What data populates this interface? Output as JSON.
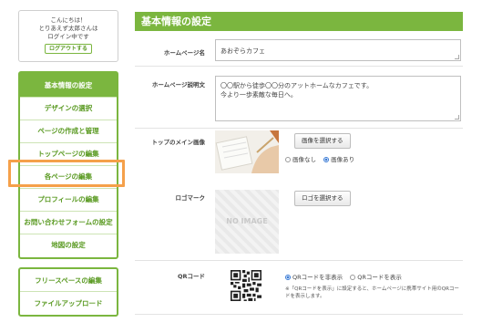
{
  "sidebar": {
    "greeting": [
      "こんにちは！",
      "とりあえず太郎さんは",
      "ログイン中です"
    ],
    "logout_label": "ログアウトする",
    "menu": [
      {
        "label": "基本情報の設定",
        "active": true
      },
      {
        "label": "デザインの選択"
      },
      {
        "label": "ページの作成と管理"
      },
      {
        "label": "トップページの編集"
      },
      {
        "label": "各ページの編集"
      },
      {
        "label": "プロフィールの編集"
      },
      {
        "label": "お問い合わせフォームの設定"
      },
      {
        "label": "地図の設定"
      }
    ],
    "menu2": [
      {
        "label": "フリースペースの編集"
      },
      {
        "label": "ファイルアップロード"
      }
    ]
  },
  "main": {
    "title": "基本情報の設定",
    "homepage_name": {
      "label": "ホームページ名",
      "value": "あおぞらカフェ"
    },
    "homepage_desc": {
      "label": "ホームページ説明文",
      "value_lines": [
        "〇〇駅から徒歩〇〇分のアットホームなカフェです。",
        "今より一歩素敵な毎日へ。"
      ]
    },
    "main_image": {
      "label": "トップのメイン画像",
      "button": "画像を選択する",
      "options": [
        {
          "label": "画像なし",
          "selected": false
        },
        {
          "label": "画像あり",
          "selected": true
        }
      ]
    },
    "logo": {
      "label": "ロゴマーク",
      "button": "ロゴを選択する",
      "placeholder": "NO IMAGE"
    },
    "qr": {
      "label": "QRコード",
      "options": [
        {
          "label": "QRコードを非表示",
          "selected": true
        },
        {
          "label": "QRコードを表示",
          "selected": false
        }
      ],
      "note": "※「QRコードを表示」に設定すると、ホームページに携帯サイト用のQRコードを表示します。"
    }
  },
  "colors": {
    "accent": "#7bb63f",
    "highlight": "#f5a04a",
    "radio": "#3a7bd5"
  }
}
